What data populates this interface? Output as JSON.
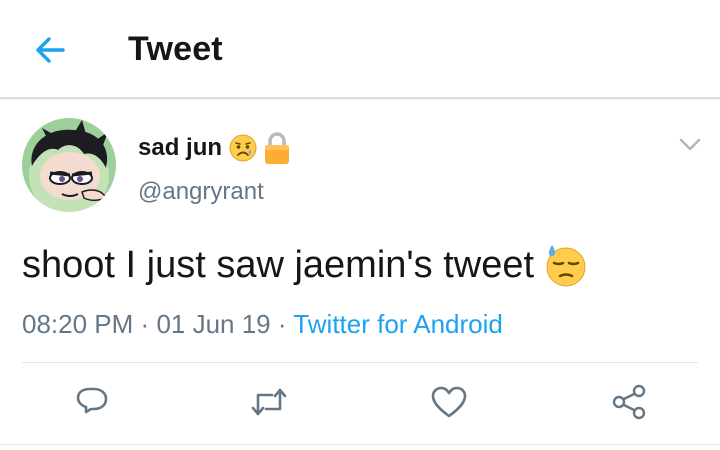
{
  "header": {
    "title": "Tweet",
    "back_icon": "arrow-left-icon"
  },
  "tweet": {
    "display_name": "sad jun",
    "name_emoji": "sad-relieved-face-emoji",
    "protected_icon": "lock-icon",
    "handle": "@angryrant",
    "text": "shoot I just saw jaemin's tweet",
    "text_emoji": "downcast-face-with-sweat-emoji",
    "time": "08:20 PM",
    "date": "01 Jun 19",
    "separator": "·",
    "source": "Twitter for Android"
  },
  "actions": [
    "reply-icon",
    "retweet-icon",
    "like-icon",
    "share-icon"
  ],
  "colors": {
    "accent": "#1da1f2",
    "text": "#14171a",
    "secondary": "#657786",
    "icon_gray": "#657786",
    "divider": "#e1e8ed"
  }
}
